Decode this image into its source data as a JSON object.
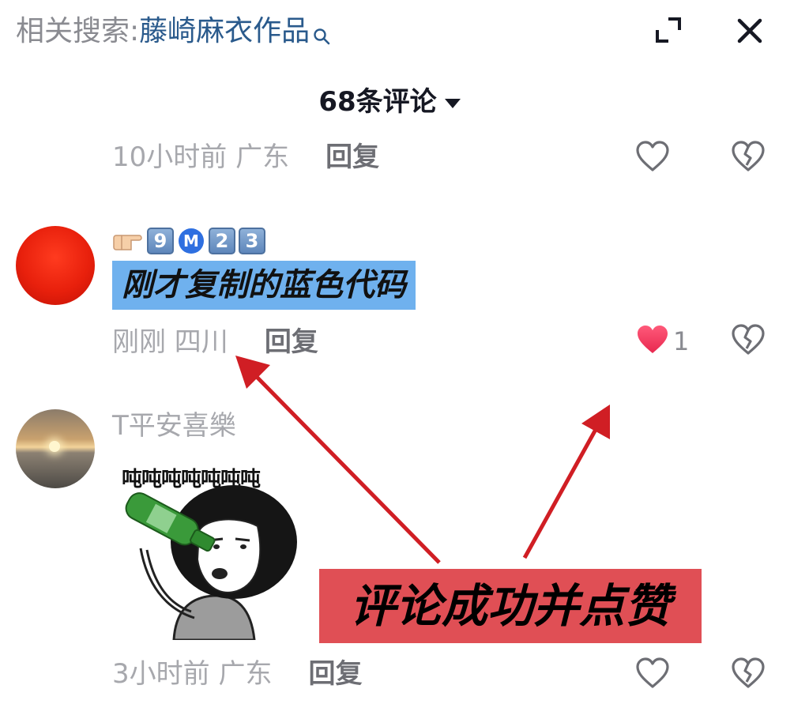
{
  "header": {
    "related_label": "相关搜索:",
    "related_query": "藤崎麻衣作品",
    "comment_count": "68条评论"
  },
  "comments": [
    {
      "time_location": "10小时前 广东",
      "reply_label": "回复"
    },
    {
      "emoji_line": [
        "👉",
        "9",
        "M",
        "2",
        "3"
      ],
      "text": "刚才复制的蓝色代码",
      "time_location": "刚刚 四川",
      "reply_label": "回复",
      "like_count": "1",
      "liked": true
    },
    {
      "username": "T平安喜樂",
      "sticker_text": "吨吨吨吨吨吨吨",
      "time_location": "3小时前 广东",
      "reply_label": "回复"
    }
  ],
  "annotation": {
    "text": "评论成功并点赞"
  },
  "colors": {
    "like_active": "#fe2c55",
    "query_blue": "#2a5a8c",
    "highlight_blue": "#6fb1ee",
    "annotation_red": "#e04f55",
    "arrow_red": "#d01e24"
  },
  "icons": [
    "search-icon",
    "expand-icon",
    "close-icon",
    "caret-down-icon",
    "heart-icon",
    "broken-heart-icon",
    "pointing-hand-icon"
  ]
}
